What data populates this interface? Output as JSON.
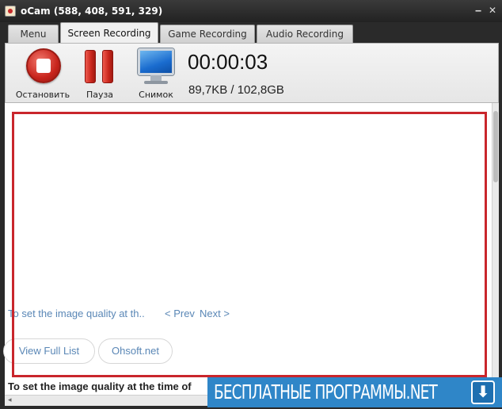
{
  "window": {
    "title": "oCam (588, 408, 591, 329)",
    "minimize_glyph": "‒",
    "close_glyph": "✕"
  },
  "tabs": [
    {
      "label": "Menu"
    },
    {
      "label": "Screen Recording",
      "active": true
    },
    {
      "label": "Game Recording"
    },
    {
      "label": "Audio Recording"
    }
  ],
  "toolbar": {
    "stop_label": "Остановить",
    "pause_label": "Пауза",
    "snapshot_label": "Снимок",
    "timer": "00:00:03",
    "size_info": "89,7KB / 102,8GB"
  },
  "content": {
    "tip_link": "To set the image quality at th..",
    "prev_label": "< Prev",
    "next_label": "Next >",
    "view_full_list": "View Full List",
    "ohsoft": "Ohsoft.net",
    "bottom_text": "To set the image quality at the time of"
  },
  "banner": {
    "text": "БЕСПЛАТНЫЕ ПРОГРАММЫ.NET",
    "arrow_glyph": "⬇"
  },
  "colors": {
    "record_frame": "#c9262c",
    "link": "#5a87b6",
    "banner": "#2f86c8"
  }
}
